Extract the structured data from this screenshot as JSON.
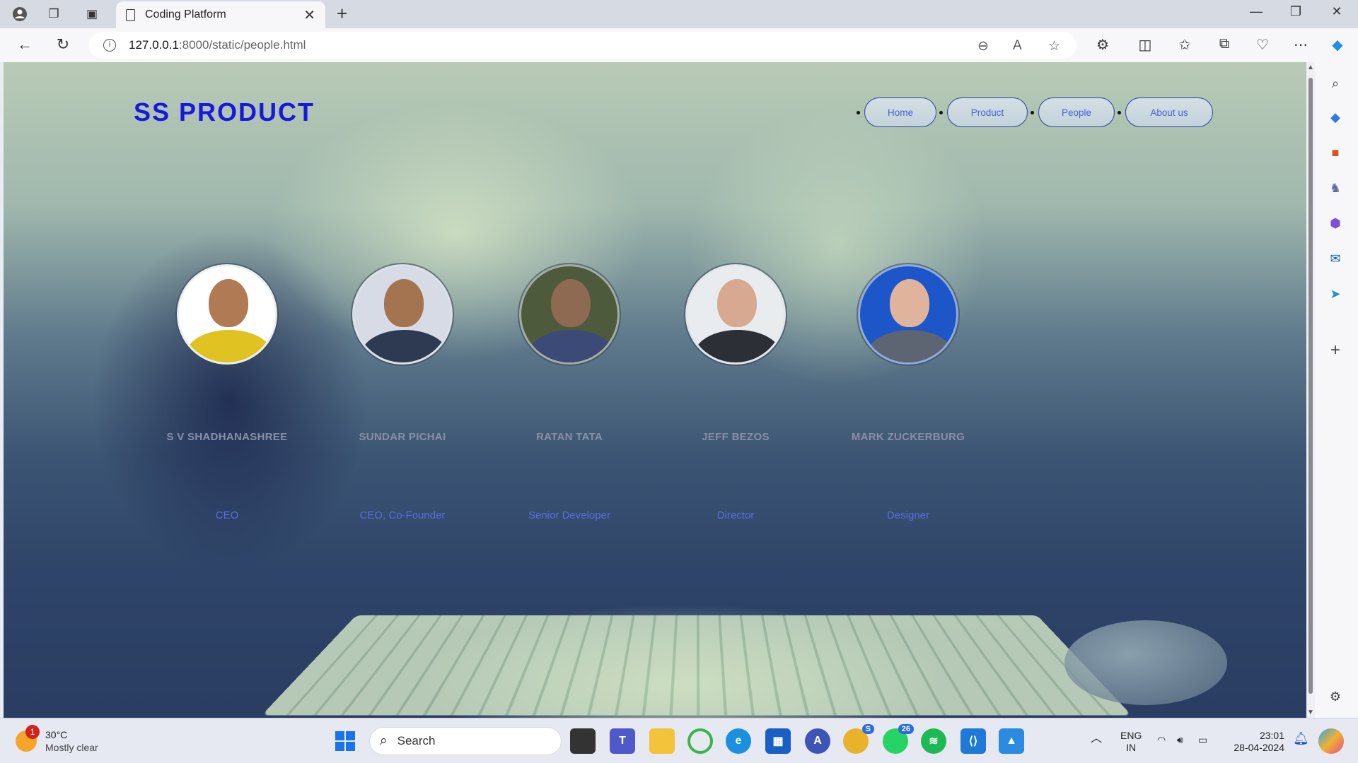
{
  "browser": {
    "tab_title": "Coding Platform",
    "url_host": "127.0.0.1",
    "url_path": ":8000/static/people.html"
  },
  "page": {
    "brand": "SS PRODUCT",
    "nav": [
      "Home",
      "Product",
      "People",
      "About us"
    ],
    "people": [
      {
        "name": "S V SHADHANASHREE",
        "role": "CEO"
      },
      {
        "name": "SUNDAR PICHAI",
        "role": "CEO, Co-Founder"
      },
      {
        "name": "RATAN TATA",
        "role": "Senior Developer"
      },
      {
        "name": "JEFF BEZOS",
        "role": "Director"
      },
      {
        "name": "MARK ZUCKERBURG",
        "role": "Designer"
      }
    ]
  },
  "taskbar": {
    "weather_temp": "30°C",
    "weather_desc": "Mostly clear",
    "weather_badge": "1",
    "search_label": "Search",
    "chrome_badge": "S",
    "whatsapp_badge": "26",
    "lang_top": "ENG",
    "lang_bottom": "IN",
    "time": "23:01",
    "date": "28-04-2024"
  },
  "colors": {
    "brand": "#1818e0",
    "nav_text": "#4b5ed8",
    "role_text": "#5a6ee0"
  }
}
